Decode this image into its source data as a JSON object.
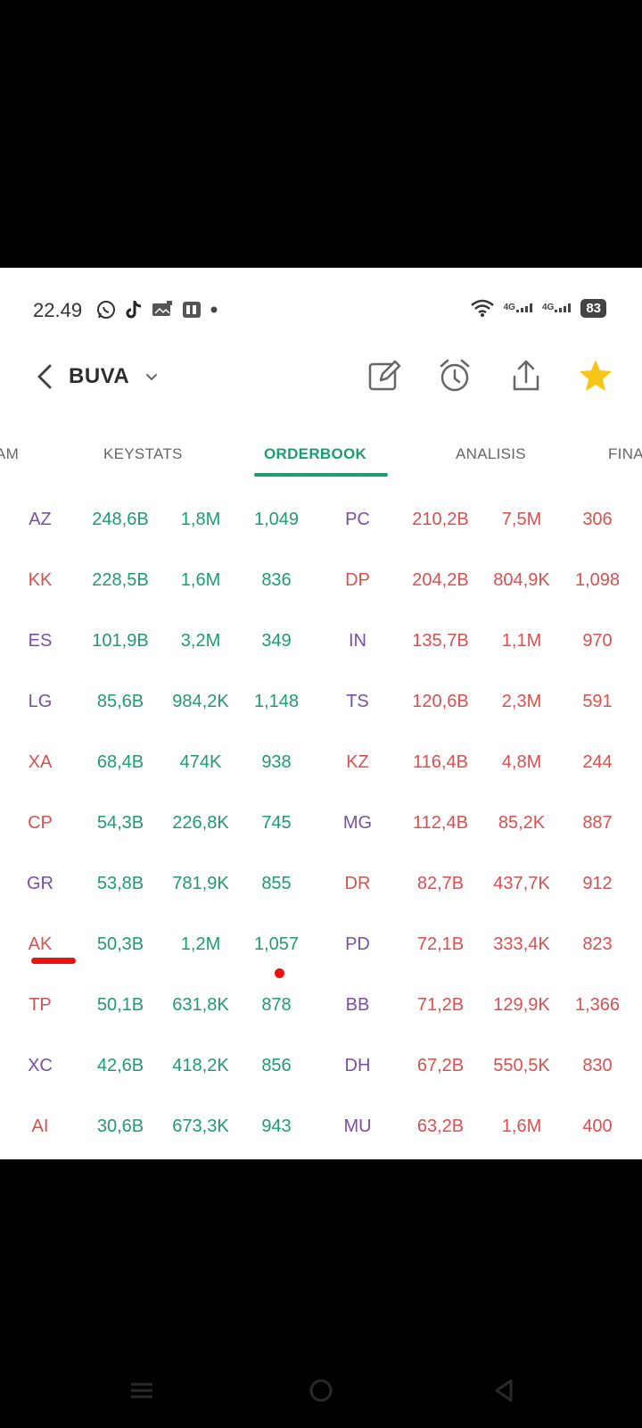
{
  "status_bar": {
    "time": "22.49",
    "left_icons": [
      "whatsapp-icon",
      "tiktok-icon",
      "gallery-icon",
      "app-icon"
    ],
    "network_1": "4G",
    "network_2": "4G",
    "battery": "83"
  },
  "header": {
    "ticker": "BUVA",
    "star_color": "#f5c518"
  },
  "tabs": [
    {
      "label": "AM"
    },
    {
      "label": "KEYSTATS"
    },
    {
      "label": "ORDERBOOK"
    },
    {
      "label": "ANALISIS"
    },
    {
      "label": "FINA"
    }
  ],
  "active_tab": "ORDERBOOK",
  "colors": {
    "accent_green": "#1f9b72",
    "sell_red": "#dc4f4f",
    "broker_purple": "#7a4fa0",
    "annotation_red": "#ee1111"
  },
  "rows": [
    {
      "buy_code": "AZ",
      "buy_value": "248,6B",
      "buy_volume": "1,8M",
      "buy_avg": "1,049",
      "sell_code": "PC",
      "sell_value": "210,2B",
      "sell_volume": "7,5M",
      "sell_avg": "306",
      "buy_code_color": "purple",
      "sell_code_color": "purple"
    },
    {
      "buy_code": "KK",
      "buy_value": "228,5B",
      "buy_volume": "1,6M",
      "buy_avg": "836",
      "sell_code": "DP",
      "sell_value": "204,2B",
      "sell_volume": "804,9K",
      "sell_avg": "1,098",
      "buy_code_color": "red",
      "sell_code_color": "red"
    },
    {
      "buy_code": "ES",
      "buy_value": "101,9B",
      "buy_volume": "3,2M",
      "buy_avg": "349",
      "sell_code": "IN",
      "sell_value": "135,7B",
      "sell_volume": "1,1M",
      "sell_avg": "970",
      "buy_code_color": "purple",
      "sell_code_color": "purple"
    },
    {
      "buy_code": "LG",
      "buy_value": "85,6B",
      "buy_volume": "984,2K",
      "buy_avg": "1,148",
      "sell_code": "TS",
      "sell_value": "120,6B",
      "sell_volume": "2,3M",
      "sell_avg": "591",
      "buy_code_color": "purple",
      "sell_code_color": "purple"
    },
    {
      "buy_code": "XA",
      "buy_value": "68,4B",
      "buy_volume": "474K",
      "buy_avg": "938",
      "sell_code": "KZ",
      "sell_value": "116,4B",
      "sell_volume": "4,8M",
      "sell_avg": "244",
      "buy_code_color": "red",
      "sell_code_color": "red"
    },
    {
      "buy_code": "CP",
      "buy_value": "54,3B",
      "buy_volume": "226,8K",
      "buy_avg": "745",
      "sell_code": "MG",
      "sell_value": "112,4B",
      "sell_volume": "85,2K",
      "sell_avg": "887",
      "buy_code_color": "red",
      "sell_code_color": "purple"
    },
    {
      "buy_code": "GR",
      "buy_value": "53,8B",
      "buy_volume": "781,9K",
      "buy_avg": "855",
      "sell_code": "DR",
      "sell_value": "82,7B",
      "sell_volume": "437,7K",
      "sell_avg": "912",
      "buy_code_color": "purple",
      "sell_code_color": "red"
    },
    {
      "buy_code": "AK",
      "buy_value": "50,3B",
      "buy_volume": "1,2M",
      "buy_avg": "1,057",
      "sell_code": "PD",
      "sell_value": "72,1B",
      "sell_volume": "333,4K",
      "sell_avg": "823",
      "buy_code_color": "red",
      "sell_code_color": "purple"
    },
    {
      "buy_code": "TP",
      "buy_value": "50,1B",
      "buy_volume": "631,8K",
      "buy_avg": "878",
      "sell_code": "BB",
      "sell_value": "71,2B",
      "sell_volume": "129,9K",
      "sell_avg": "1,366",
      "buy_code_color": "red",
      "sell_code_color": "purple"
    },
    {
      "buy_code": "XC",
      "buy_value": "42,6B",
      "buy_volume": "418,2K",
      "buy_avg": "856",
      "sell_code": "DH",
      "sell_value": "67,2B",
      "sell_volume": "550,5K",
      "sell_avg": "830",
      "buy_code_color": "purple",
      "sell_code_color": "purple"
    },
    {
      "buy_code": "AI",
      "buy_value": "30,6B",
      "buy_volume": "673,3K",
      "buy_avg": "943",
      "sell_code": "MU",
      "sell_value": "63,2B",
      "sell_volume": "1,6M",
      "sell_avg": "400",
      "buy_code_color": "red",
      "sell_code_color": "purple"
    }
  ],
  "navbar": [
    "menu-icon",
    "home-icon",
    "back-icon"
  ]
}
